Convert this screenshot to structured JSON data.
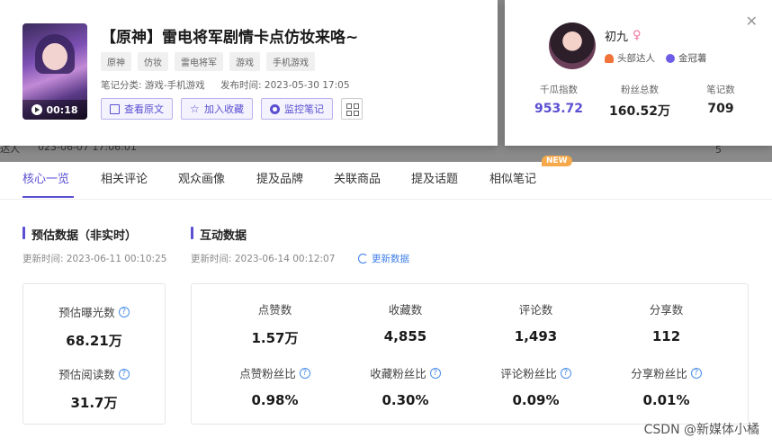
{
  "background": {
    "row_label": "达人",
    "row_date": "023-06-07 17:06:01",
    "row_right": "5"
  },
  "note": {
    "duration": "00:18",
    "title": "【原神】雷电将军剧情卡点仿妆来咯~",
    "tags": [
      "原神",
      "仿妆",
      "雷电将军",
      "游戏",
      "手机游戏"
    ],
    "category": "笔记分类: 游戏-手机游戏",
    "published": "发布时间: 2023-05-30 17:05",
    "actions": {
      "view_original": "查看原文",
      "add_favorite": "加入收藏",
      "monitor_note": "监控笔记"
    }
  },
  "author": {
    "name": "初九",
    "badges": [
      "头部达人",
      "金冠薯"
    ],
    "stats": [
      {
        "label": "千瓜指数",
        "value": "953.72"
      },
      {
        "label": "粉丝总数",
        "value": "160.52万"
      },
      {
        "label": "笔记数",
        "value": "709"
      }
    ]
  },
  "tabs": [
    "核心一览",
    "相关评论",
    "观众画像",
    "提及品牌",
    "关联商品",
    "提及话题",
    "相似笔记"
  ],
  "new_badge": "NEW",
  "estimate": {
    "title": "预估数据（非实时）",
    "updated": "更新时间: 2023-06-11 00:10:25",
    "items": [
      {
        "label": "预估曝光数",
        "value": "68.21万"
      },
      {
        "label": "预估阅读数",
        "value": "31.7万"
      }
    ]
  },
  "interaction": {
    "title": "互动数据",
    "updated": "更新时间: 2023-06-14 00:12:07",
    "refresh": "更新数据",
    "row1": [
      {
        "label": "点赞数",
        "value": "1.57万"
      },
      {
        "label": "收藏数",
        "value": "4,855"
      },
      {
        "label": "评论数",
        "value": "1,493"
      },
      {
        "label": "分享数",
        "value": "112"
      }
    ],
    "row2": [
      {
        "label": "点赞粉丝比",
        "value": "0.98%"
      },
      {
        "label": "收藏粉丝比",
        "value": "0.30%"
      },
      {
        "label": "评论粉丝比",
        "value": "0.09%"
      },
      {
        "label": "分享粉丝比",
        "value": "0.01%"
      }
    ]
  },
  "watermark": "CSDN @新媒体小橘",
  "colors": {
    "accent": "#5b4fd2",
    "link": "#3d7de8",
    "new_badge": "#f6a94a",
    "female": "#f26f9d"
  }
}
